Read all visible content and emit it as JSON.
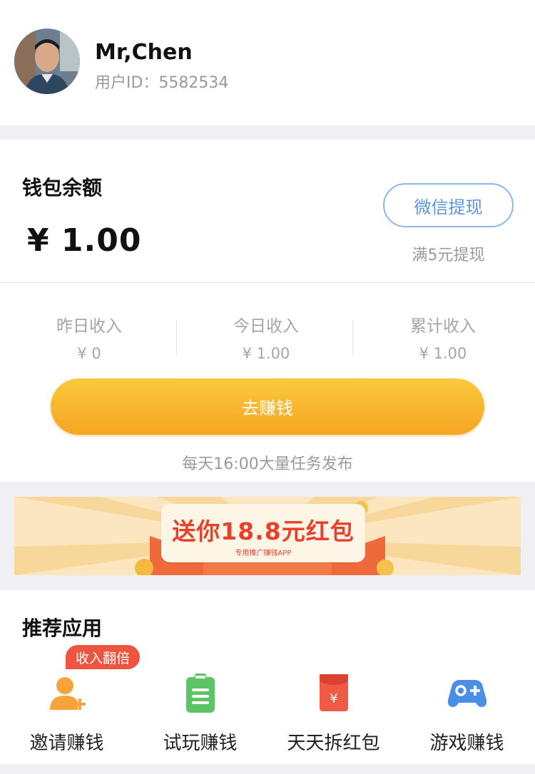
{
  "profile": {
    "name": "Mr,Chen",
    "user_id": "用户ID：5582534",
    "avatar_icon": "user-avatar-photo"
  },
  "wallet": {
    "title": "钱包余额",
    "balance": "¥ 1.00",
    "withdraw_label": "微信提现",
    "withdraw_note": "满5元提现",
    "stats": [
      {
        "label": "昨日收入",
        "value": "¥ 0"
      },
      {
        "label": "今日收入",
        "value": "¥ 1.00"
      },
      {
        "label": "累计收入",
        "value": "¥ 1.00"
      }
    ],
    "earn_label": "去赚钱",
    "earn_note": "每天16:00大量任务发布"
  },
  "banner": {
    "title": "送你18.8元红包",
    "subtitle": "专用推广赚钱APP"
  },
  "apps": {
    "title": "推荐应用",
    "badge": "收入翻倍",
    "items": [
      {
        "label": "邀请赚钱",
        "icon": "add-user-icon",
        "color": "#f5a33a"
      },
      {
        "label": "试玩赚钱",
        "icon": "clipboard-icon",
        "color": "#5bc465"
      },
      {
        "label": "天天拆红包",
        "icon": "red-envelope-icon",
        "color": "#ee5a45"
      },
      {
        "label": "游戏赚钱",
        "icon": "gamepad-icon",
        "color": "#4a8ee8"
      }
    ]
  },
  "colors": {
    "accent_blue": "#5b95de",
    "button_yellow": "#f5a623",
    "badge_red": "#ee5540",
    "background": "#efeff4"
  }
}
